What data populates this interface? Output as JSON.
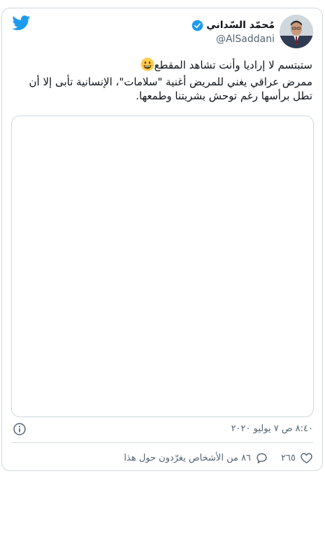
{
  "tweet": {
    "author_name": "مُحمّد السّداني",
    "handle": "@AlSaddani",
    "text_line1": "ستبتسم لا إراديا وأنت تشاهد المقطع",
    "text_body": "ممرض عراقي يغني للمريض أغنية \"سلامات\"، الإنسانية تأبى إلا أن تطل برأسها رغم توحش بشريتنا وطمعها.",
    "emoji": "😃",
    "timestamp": "٨:٤٠ ص ٧ يوليو ٢٠٢٠",
    "likes": "٢٦٥",
    "replies_label": "٨٦ من الأشخاص يغرّدون حول هذا"
  },
  "colors": {
    "twitter_blue": "#1d9bf0",
    "border": "#cfd9de",
    "secondary_text": "#536471",
    "primary_text": "#0f1419"
  },
  "icons": {
    "logo": "twitter-bird-icon",
    "verified": "verified-badge-icon",
    "info": "info-icon",
    "like": "heart-icon",
    "reply": "reply-bubble-icon"
  }
}
